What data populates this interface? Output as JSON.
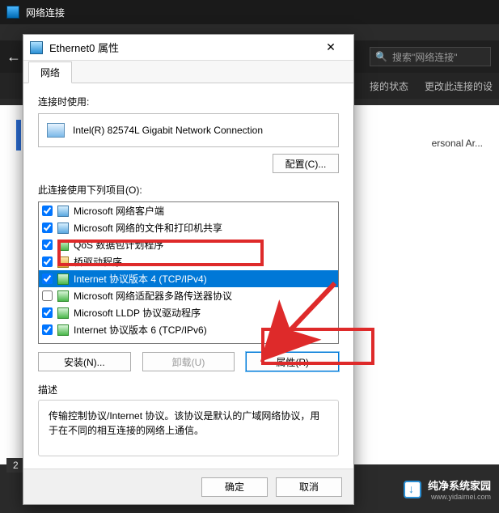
{
  "bg_window": {
    "title": "网络连接",
    "search_placeholder": "搜索\"网络连接\"",
    "toolbar": {
      "back": "←",
      "status": "接的状态",
      "change": "更改此连接的设"
    },
    "body_text": "ersonal Ar...",
    "page_badge": "2"
  },
  "dialog": {
    "title": "Ethernet0 属性",
    "tab": "网络",
    "connect_using": "连接时使用:",
    "adapter": "Intel(R) 82574L Gigabit Network Connection",
    "configure_btn": "配置(C)...",
    "items_label": "此连接使用下列项目(O):",
    "items": [
      {
        "label": "Microsoft 网络客户端",
        "checked": true,
        "icon": "client"
      },
      {
        "label": "Microsoft 网络的文件和打印机共享",
        "checked": true,
        "icon": "client"
      },
      {
        "label": "QoS 数据包计划程序",
        "checked": true,
        "icon": "proto"
      },
      {
        "label": "桥驱动程序",
        "checked": true,
        "icon": "drv"
      },
      {
        "label": "Internet 协议版本 4 (TCP/IPv4)",
        "checked": true,
        "icon": "proto",
        "selected": true
      },
      {
        "label": "Microsoft 网络适配器多路传送器协议",
        "checked": false,
        "icon": "proto"
      },
      {
        "label": "Microsoft LLDP 协议驱动程序",
        "checked": true,
        "icon": "proto"
      },
      {
        "label": "Internet 协议版本 6 (TCP/IPv6)",
        "checked": true,
        "icon": "proto"
      }
    ],
    "install_btn": "安装(N)...",
    "uninstall_btn": "卸载(U)",
    "properties_btn": "属性(R)",
    "desc_label": "描述",
    "desc_text": "传输控制协议/Internet 协议。该协议是默认的广域网络协议，用于在不同的相互连接的网络上通信。",
    "ok": "确定",
    "cancel": "取消"
  },
  "footer": {
    "brand": "纯净系统家园",
    "url": "www.yidaimei.com"
  }
}
